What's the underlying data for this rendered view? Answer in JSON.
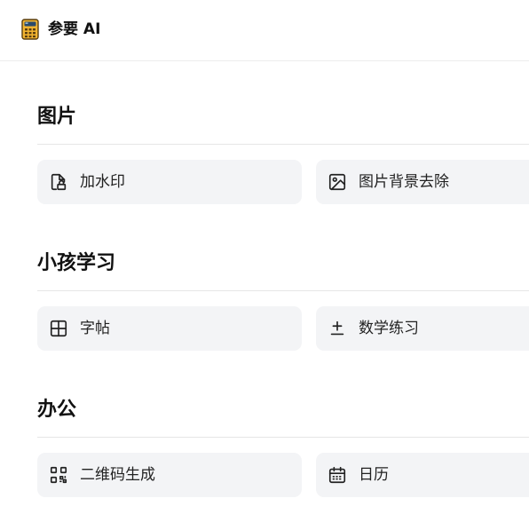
{
  "header": {
    "app_name": "参要 AI",
    "logo_icon": "calculator-icon"
  },
  "sections": [
    {
      "title": "图片",
      "tools": [
        {
          "label": "加水印",
          "icon": "file-lock-icon"
        },
        {
          "label": "图片背景去除",
          "icon": "image-icon"
        }
      ]
    },
    {
      "title": "小孩学习",
      "tools": [
        {
          "label": "字帖",
          "icon": "grid-icon"
        },
        {
          "label": "数学练习",
          "icon": "plus-minus-icon"
        }
      ]
    },
    {
      "title": "办公",
      "tools": [
        {
          "label": "二维码生成",
          "icon": "qr-code-icon"
        },
        {
          "label": "日历",
          "icon": "calendar-icon"
        }
      ]
    }
  ],
  "colors": {
    "card_bg": "#f3f4f6",
    "logo_body": "#f2b431",
    "logo_screen": "#2a4a6b"
  }
}
